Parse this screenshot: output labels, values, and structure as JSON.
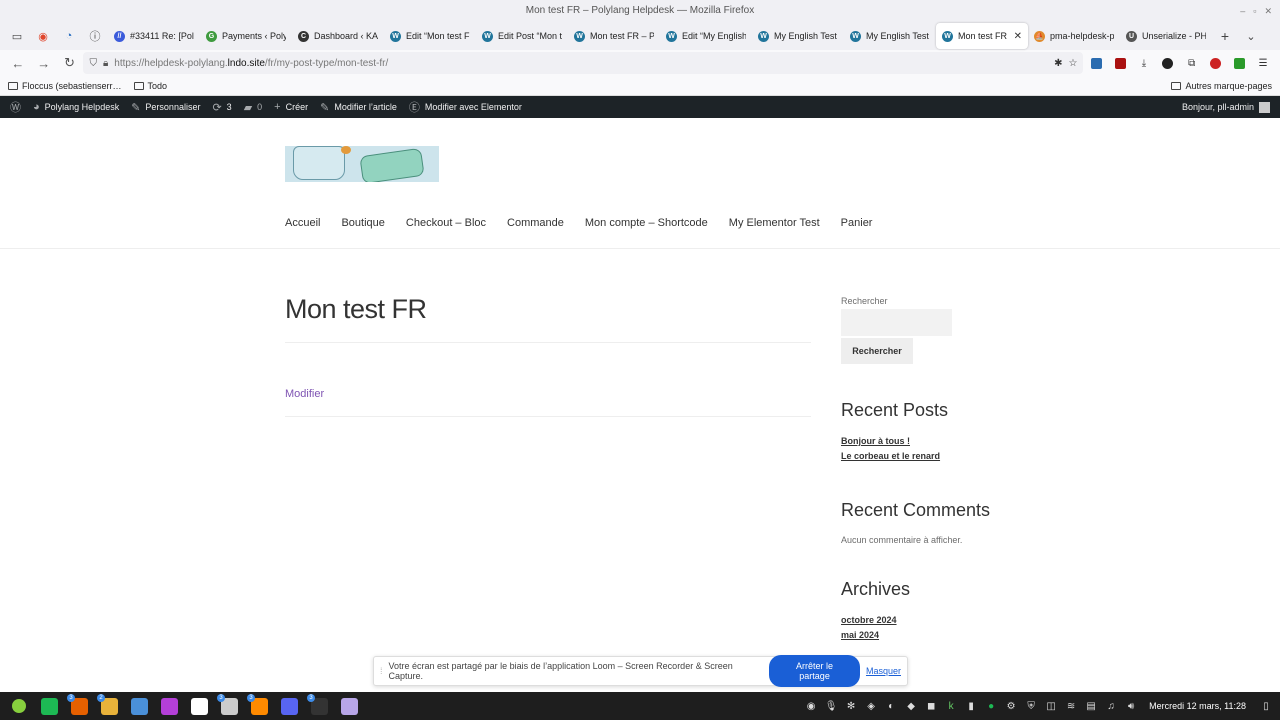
{
  "window": {
    "title": "Mon test FR – Polylang Helpdesk — Mozilla Firefox"
  },
  "tabs": [
    {
      "label": "#33411 Re: [Pol",
      "color": "#3b5bdb",
      "glyph": "//"
    },
    {
      "label": "Payments ‹ Poly",
      "color": "#3f9b3f",
      "glyph": "G"
    },
    {
      "label": "Dashboard ‹ KA",
      "color": "#333333",
      "glyph": "C"
    },
    {
      "label": "Edit “Mon test F",
      "color": "#21759b",
      "glyph": "W"
    },
    {
      "label": "Edit Post “Mon t",
      "color": "#21759b",
      "glyph": "W"
    },
    {
      "label": "Mon test FR – Po",
      "color": "#21759b",
      "glyph": "W"
    },
    {
      "label": "Edit “My English",
      "color": "#21759b",
      "glyph": "W"
    },
    {
      "label": "My English Test",
      "color": "#21759b",
      "glyph": "W"
    },
    {
      "label": "My English Test",
      "color": "#21759b",
      "glyph": "W"
    },
    {
      "label": "Mon test FR -",
      "color": "#21759b",
      "glyph": "W",
      "active": true
    },
    {
      "label": "pma-helpdesk-p",
      "color": "#e08a2c",
      "glyph": "⛵"
    },
    {
      "label": "Unserialize - PH",
      "color": "#555555",
      "glyph": "U"
    }
  ],
  "nav": {
    "url_prefix": "https://helpdesk-polylang.",
    "url_domain": "lndo.site",
    "url_path": "/fr/my-post-type/mon-test-fr/"
  },
  "bookmarks": {
    "left": [
      "Floccus (sebastienserr…",
      "Todo"
    ],
    "right": "Autres marque-pages"
  },
  "adminbar": {
    "site_name": "Polylang Helpdesk",
    "customize": "Personnaliser",
    "updates_count": "3",
    "comments_count": "0",
    "new": "Créer",
    "edit_post": "Modifier l’article",
    "edit_elementor": "Modifier avec Elementor",
    "greeting": "Bonjour, pll-admin"
  },
  "menu": [
    "Accueil",
    "Boutique",
    "Checkout – Bloc",
    "Commande",
    "Mon compte – Shortcode",
    "My Elementor Test",
    "Panier"
  ],
  "post": {
    "title": "Mon test FR",
    "edit_link": "Modifier"
  },
  "sidebar": {
    "search_label": "Rechercher",
    "search_button": "Rechercher",
    "recent_posts_title": "Recent Posts",
    "recent_posts": [
      "Bonjour à tous !",
      "Le corbeau et le renard"
    ],
    "recent_comments_title": "Recent Comments",
    "no_comments": "Aucun commentaire à afficher.",
    "archives_title": "Archives",
    "archives": [
      "octobre 2024",
      "mai 2024"
    ]
  },
  "loom": {
    "message": "Votre écran est partagé par le biais de l’application Loom – Screen Recorder & Screen Capture.",
    "stop": "Arrêter le partage",
    "hide": "Masquer"
  },
  "taskbar": {
    "apps": [
      {
        "name": "spotify",
        "color": "#1db954"
      },
      {
        "name": "firefox",
        "color": "#e66000",
        "badge": "3"
      },
      {
        "name": "files",
        "color": "#e8b23a",
        "badge": "2"
      },
      {
        "name": "mail",
        "color": "#4a90d9"
      },
      {
        "name": "phpstorm",
        "color": "#b43fd8"
      },
      {
        "name": "slack",
        "color": "#ffffff"
      },
      {
        "name": "terminal-window",
        "color": "#cccccc",
        "badge": "3"
      },
      {
        "name": "sublime",
        "color": "#ff8a00",
        "badge": "3"
      },
      {
        "name": "discord",
        "color": "#5865f2"
      },
      {
        "name": "terminal",
        "color": "#333333",
        "badge": "3"
      },
      {
        "name": "notes",
        "color": "#b8a6e8"
      }
    ],
    "clock": "Mercredi 12 mars, 11:28"
  }
}
